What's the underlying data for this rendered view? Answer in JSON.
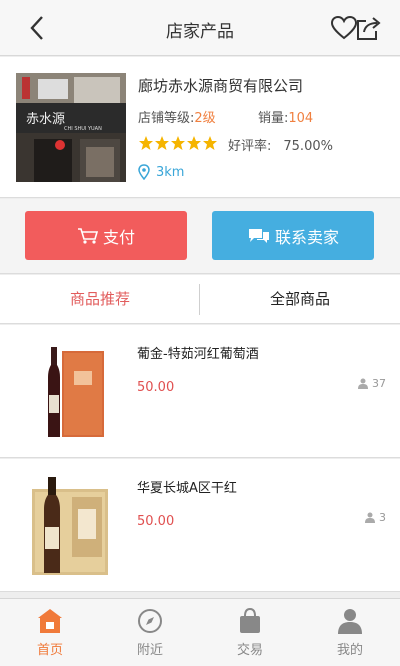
{
  "header": {
    "title": "店家产品"
  },
  "shop": {
    "name": "廊坊赤水源商贸有限公司",
    "level_label": "店铺等级:",
    "level_value": "2级",
    "sales_label": "销量:",
    "sales_value": "104",
    "rating_label": "好评率:",
    "rating_value": "75.00%",
    "stars": 5,
    "distance": "3km",
    "photo_sign": "赤水源",
    "photo_sign_en": "CHI SHUI YUAN"
  },
  "actions": {
    "pay": "支付",
    "contact": "联系卖家"
  },
  "tabs": {
    "recommend": "商品推荐",
    "all": "全部商品"
  },
  "products": [
    {
      "name": "葡金-特茹河红葡萄酒",
      "price": "50.00",
      "count": "37"
    },
    {
      "name": "华夏长城A区干红",
      "price": "50.00",
      "count": "3"
    }
  ],
  "tabbar": {
    "home": "首页",
    "nearby": "附近",
    "trade": "交易",
    "mine": "我的"
  },
  "colors": {
    "pay": "#f25c5c",
    "contact": "#45aee0",
    "accent": "#f07a3a",
    "price": "#e05050"
  }
}
